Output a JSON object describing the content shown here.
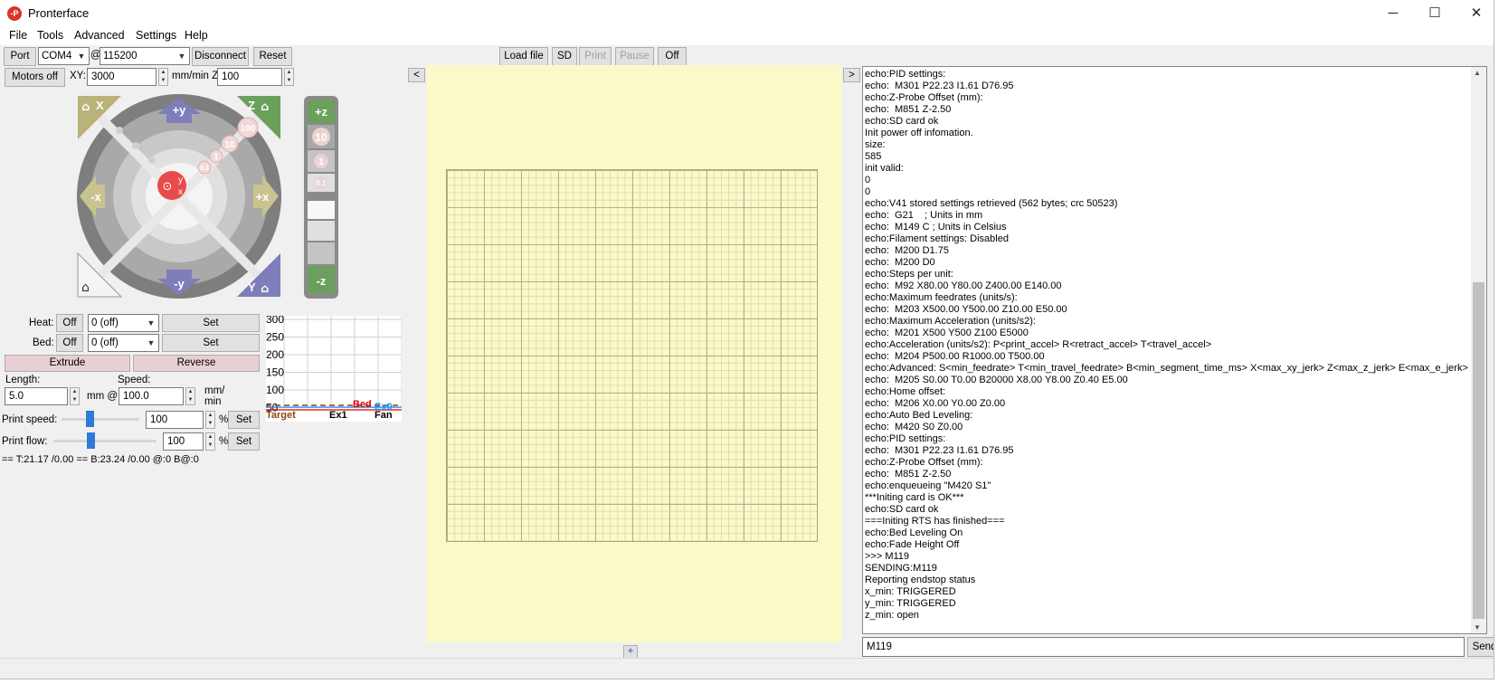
{
  "window": {
    "title": "Pronterface",
    "minimize": "─",
    "maximize": "☐",
    "close": "✕"
  },
  "menu": [
    "File",
    "Tools",
    "Advanced",
    "Settings",
    "Help"
  ],
  "toolbar": {
    "port_label": "Port",
    "port_value": "COM4",
    "at": "@",
    "baud_value": "115200",
    "disconnect": "Disconnect",
    "reset": "Reset",
    "load_file": "Load file",
    "sd": "SD",
    "print": "Print",
    "pause": "Pause",
    "off": "Off"
  },
  "motion": {
    "motors_off": "Motors off",
    "xy_label": "XY:",
    "xy_feed": "3000",
    "mm_min_z": "mm/min Z:",
    "z_feed": "100"
  },
  "jog": {
    "home_x": "X",
    "home_z": "Z",
    "home_y": "Y",
    "plus_y": "+y",
    "minus_y": "-y",
    "plus_x": "+x",
    "minus_x": "-x",
    "steps": [
      "100",
      "10",
      "1",
      "0.1"
    ],
    "plus_z": "+z",
    "minus_z": "-z",
    "z_steps": [
      "10",
      "1",
      "0.1"
    ],
    "center_y": "y",
    "center_x": "x"
  },
  "temps": {
    "heat_label": "Heat:",
    "heat_off": "Off",
    "heat_value": "0 (off)",
    "heat_set": "Set",
    "bed_label": "Bed:",
    "bed_off": "Off",
    "bed_value": "0 (off)",
    "bed_set": "Set"
  },
  "extrude": {
    "extrude": "Extrude",
    "reverse": "Reverse",
    "length_label": "Length:",
    "length_value": "5.0",
    "mm_at": "mm @",
    "speed_label": "Speed:",
    "speed_value": "100.0",
    "mm_min": "mm/\nmin"
  },
  "print_speed": {
    "label": "Print speed:",
    "value": "100",
    "percent": "%",
    "set": "Set",
    "level": 0.36
  },
  "print_flow": {
    "label": "Print flow:",
    "value": "100",
    "percent": "%",
    "set": "Set",
    "level": 0.36
  },
  "graph": {
    "ticks": [
      "300",
      "250",
      "200",
      "150",
      "100",
      "50"
    ],
    "legend": {
      "target": "Target",
      "ex1": "Ex1",
      "bed": "Bed",
      "fan": "Fan",
      "ex0": "Ex0"
    },
    "colors": {
      "target": "#8b4513",
      "bed": "#e00000",
      "ex0": "#1e90ff",
      "grid": "#d0d0d0"
    }
  },
  "status_temps": "== T:21.17 /0.00 == B:23.24 /0.00 @:0 B@:0",
  "canvas": {
    "collapse_left": "<",
    "collapse_right": ">",
    "add": "+"
  },
  "console": {
    "lines": [
      "echo:PID settings:",
      "echo:  M301 P22.23 I1.61 D76.95",
      "echo:Z-Probe Offset (mm):",
      "echo:  M851 Z-2.50",
      "echo:SD card ok",
      "Init power off infomation.",
      "size:",
      "585",
      "init valid:",
      "0",
      "0",
      "echo:V41 stored settings retrieved (562 bytes; crc 50523)",
      "echo:  G21    ; Units in mm",
      "echo:  M149 C ; Units in Celsius",
      "echo:Filament settings: Disabled",
      "echo:  M200 D1.75",
      "echo:  M200 D0",
      "echo:Steps per unit:",
      "echo:  M92 X80.00 Y80.00 Z400.00 E140.00",
      "echo:Maximum feedrates (units/s):",
      "echo:  M203 X500.00 Y500.00 Z10.00 E50.00",
      "echo:Maximum Acceleration (units/s2):",
      "echo:  M201 X500 Y500 Z100 E5000",
      "echo:Acceleration (units/s2): P<print_accel> R<retract_accel> T<travel_accel>",
      "echo:  M204 P500.00 R1000.00 T500.00",
      "echo:Advanced: S<min_feedrate> T<min_travel_feedrate> B<min_segment_time_ms> X<max_xy_jerk> Z<max_z_jerk> E<max_e_jerk>",
      "echo:  M205 S0.00 T0.00 B20000 X8.00 Y8.00 Z0.40 E5.00",
      "echo:Home offset:",
      "echo:  M206 X0.00 Y0.00 Z0.00",
      "echo:Auto Bed Leveling:",
      "echo:  M420 S0 Z0.00",
      "echo:PID settings:",
      "echo:  M301 P22.23 I1.61 D76.95",
      "echo:Z-Probe Offset (mm):",
      "echo:  M851 Z-2.50",
      "echo:enqueueing \"M420 S1\"",
      "***Initing card is OK***",
      "echo:SD card ok",
      "===Initing RTS has finished===",
      "echo:Bed Leveling On",
      "echo:Fade Height Off",
      ">>> M119",
      "SENDING:M119",
      "Reporting endstop status",
      "x_min: TRIGGERED",
      "y_min: TRIGGERED",
      "z_min: open"
    ],
    "input_value": "M119",
    "send": "Send"
  }
}
